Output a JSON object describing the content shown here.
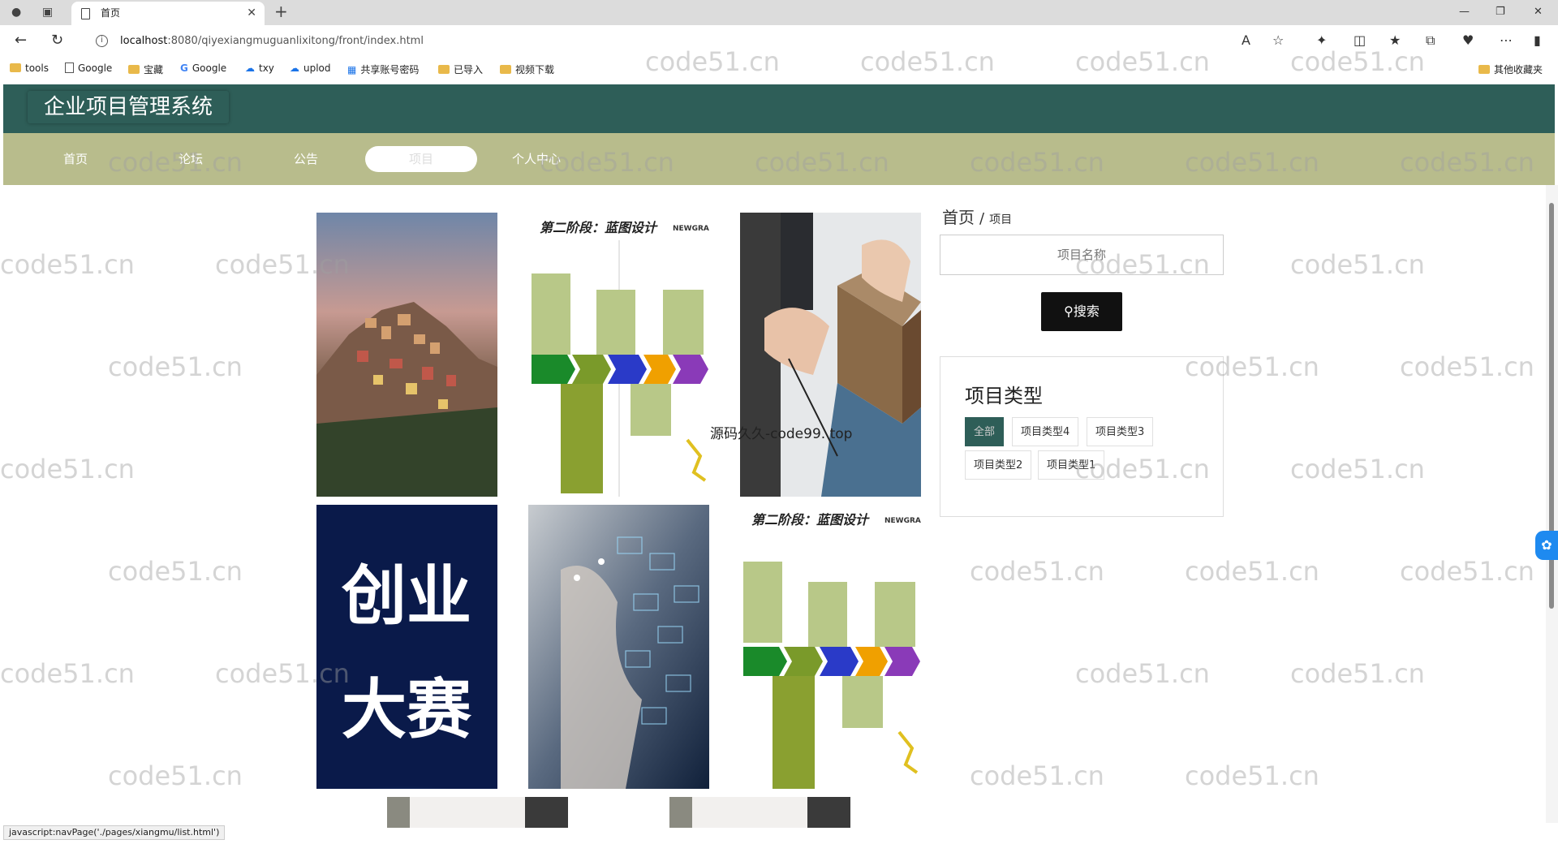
{
  "browser": {
    "tab_title": "首页",
    "url_host": "localhost",
    "url_rest": ":8080/qiyexiangmuguanlixitong/front/index.html",
    "bookmarks": [
      "tools",
      "Google",
      "宝藏",
      "Google",
      "txy",
      "uplod",
      "共享账号密码",
      "已导入",
      "视频下载"
    ],
    "other_bookmarks": "其他收藏夹"
  },
  "site": {
    "title": "企业项目管理系统",
    "nav": [
      "首页",
      "论坛",
      "公告",
      "项目",
      "个人中心"
    ]
  },
  "breadcrumb": {
    "home": "首页",
    "sep": "/",
    "current": "项目"
  },
  "search": {
    "placeholder": "项目名称",
    "button": "搜索"
  },
  "types": {
    "title": "项目类型",
    "items": [
      "全部",
      "项目类型4",
      "项目类型3",
      "项目类型2",
      "项目类型1"
    ]
  },
  "projects": {
    "cards": [
      {
        "kind": "village-photo"
      },
      {
        "kind": "blueprint-diagram",
        "heading": "第二阶段：蓝图设计",
        "brand": "NEWGRAND"
      },
      {
        "kind": "architect-photo"
      },
      {
        "kind": "startup-poster",
        "line1": "创业",
        "line2": "大赛"
      },
      {
        "kind": "tech-hand-photo"
      },
      {
        "kind": "blueprint-diagram",
        "heading": "第二阶段：蓝图设计",
        "brand": "NEWGRAND"
      }
    ]
  },
  "overlay_text": "源码久久-code99. top",
  "status_bar": "javascript:navPage('./pages/xiangmu/list.html')",
  "watermark": "code51.cn",
  "colors": {
    "header": "#2e5e58",
    "nav": "#b8bc8c",
    "accent": "#2e5e58"
  }
}
